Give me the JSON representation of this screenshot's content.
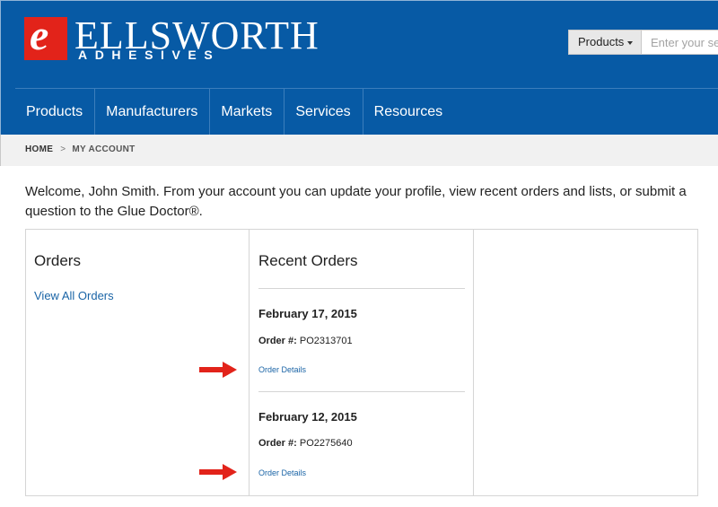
{
  "brand": {
    "mark": "e",
    "name": "ELLSWORTH",
    "sub": "ADHESIVES",
    "red": "#e2231a",
    "blue": "#075aa5"
  },
  "search": {
    "dropdown_label": "Products",
    "placeholder": "Enter your se"
  },
  "nav": {
    "items": [
      "Products",
      "Manufacturers",
      "Markets",
      "Services",
      "Resources"
    ]
  },
  "breadcrumb": {
    "home": "HOME",
    "separator": ">",
    "current": "MY ACCOUNT"
  },
  "welcome_text": "Welcome, John Smith. From your account you can update your profile, view recent orders and lists, or submit a question to the Glue Doctor®.",
  "orders_panel": {
    "title": "Orders",
    "view_all": "View All Orders"
  },
  "recent_orders": {
    "title": "Recent Orders",
    "order_label": "Order #:",
    "details_label": "Order Details",
    "items": [
      {
        "date": "February 17, 2015",
        "number": "PO2313701"
      },
      {
        "date": "February 12, 2015",
        "number": "PO2275640"
      }
    ]
  },
  "annotation_arrow_color": "#e2231a"
}
